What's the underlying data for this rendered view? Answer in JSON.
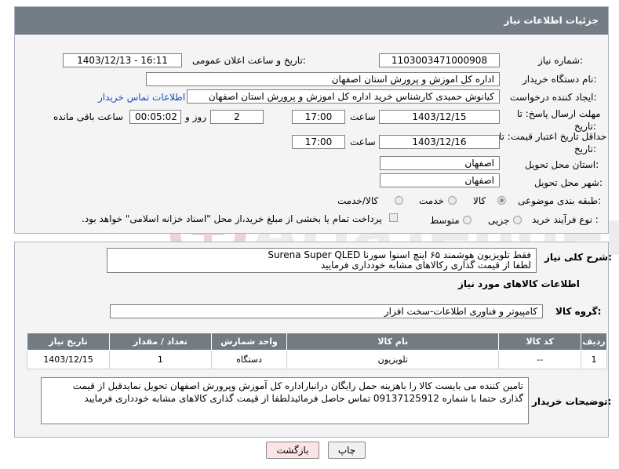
{
  "header": {
    "title": "جزئیات اطلاعات نیاز"
  },
  "form": {
    "need_number": {
      "label": "شماره نیاز:",
      "value": "1103003471000908"
    },
    "announce_datetime": {
      "label": "تاریخ و ساعت اعلان عمومی:",
      "value": "1403/12/13 - 16:11"
    },
    "buyer_org": {
      "label": "نام دستگاه خریدار:",
      "value": "اداره کل اموزش و پرورش استان اصفهان"
    },
    "requester": {
      "label": "ایجاد کننده درخواست:",
      "value": "کیانوش حمیدی کارشناس خرید اداره کل اموزش و پرورش استان اصفهان",
      "contact_link": "اطلاعات تماس خریدار"
    },
    "reply_deadline": {
      "label_line1": "مهلت ارسال پاسخ: تا",
      "label_line2": "تاریخ:",
      "date": "1403/12/15",
      "time_label": "ساعت",
      "time": "17:00",
      "days": "2",
      "days_label": "روز و",
      "remaining": "00:05:02",
      "remaining_label": "ساعت باقی مانده"
    },
    "price_validity": {
      "label_line1": "حداقل تاریخ اعتبار قیمت: تا",
      "label_line2": "تاریخ:",
      "date": "1403/12/16",
      "time_label": "ساعت",
      "time": "17:00"
    },
    "delivery_province": {
      "label": "استان محل تحویل:",
      "value": "اصفهان"
    },
    "delivery_city": {
      "label": "شهر محل تحویل:",
      "value": "اصفهان"
    },
    "category": {
      "label": "طبقه بندی موضوعی:",
      "options": [
        "کالا",
        "خدمت",
        "کالا/خدمت"
      ],
      "selected": "کالا"
    },
    "purchase_type": {
      "label": "نوع فرآیند خرید :",
      "options": [
        "جزیی",
        "متوسط"
      ],
      "payment_note": "پرداخت تمام یا بخشی از مبلغ خرید،از محل \"اسناد خزانه اسلامی\" خواهد بود."
    }
  },
  "description": {
    "label": "شرح کلی نیاز:",
    "line1": "فقط تلویزیون هوشمند ۶۵ اینچ اسنوا سورنا   Surena Super QLED",
    "line2": "لطفا از قیمت گذاری رکالاهای مشابه خودداری فرمایید"
  },
  "items_section": {
    "title": "اطلاعات کالاهای مورد نیاز",
    "group_label": "گروه کالا:",
    "group_value": "کامپیوتر و فناوری اطلاعات-سخت افزار",
    "columns": [
      "ردیف",
      "کد کالا",
      "نام کالا",
      "واحد شمارش",
      "تعداد / مقدار",
      "تاریخ نیاز"
    ],
    "rows": [
      [
        "1",
        "--",
        "تلویزیون",
        "دستگاه",
        "1",
        "1403/12/15"
      ]
    ]
  },
  "buyer_notes": {
    "label": "توضیحات خریدار:",
    "text": "تامین کننده می بایست کالا را باهزینه حمل رایگان درانباراداره کل آموزش وپرورش  اصفهان تحویل نمایدقبل از قیمت گذاری حتما با شماره 09137125912 تماس حاصل فرمائیدلطفا از قیمت گذاری کالاهای مشابه خودداری فرمایید"
  },
  "buttons": {
    "print": "چاپ",
    "back": "بازگشت"
  },
  "watermark": "AriaTender.neT"
}
